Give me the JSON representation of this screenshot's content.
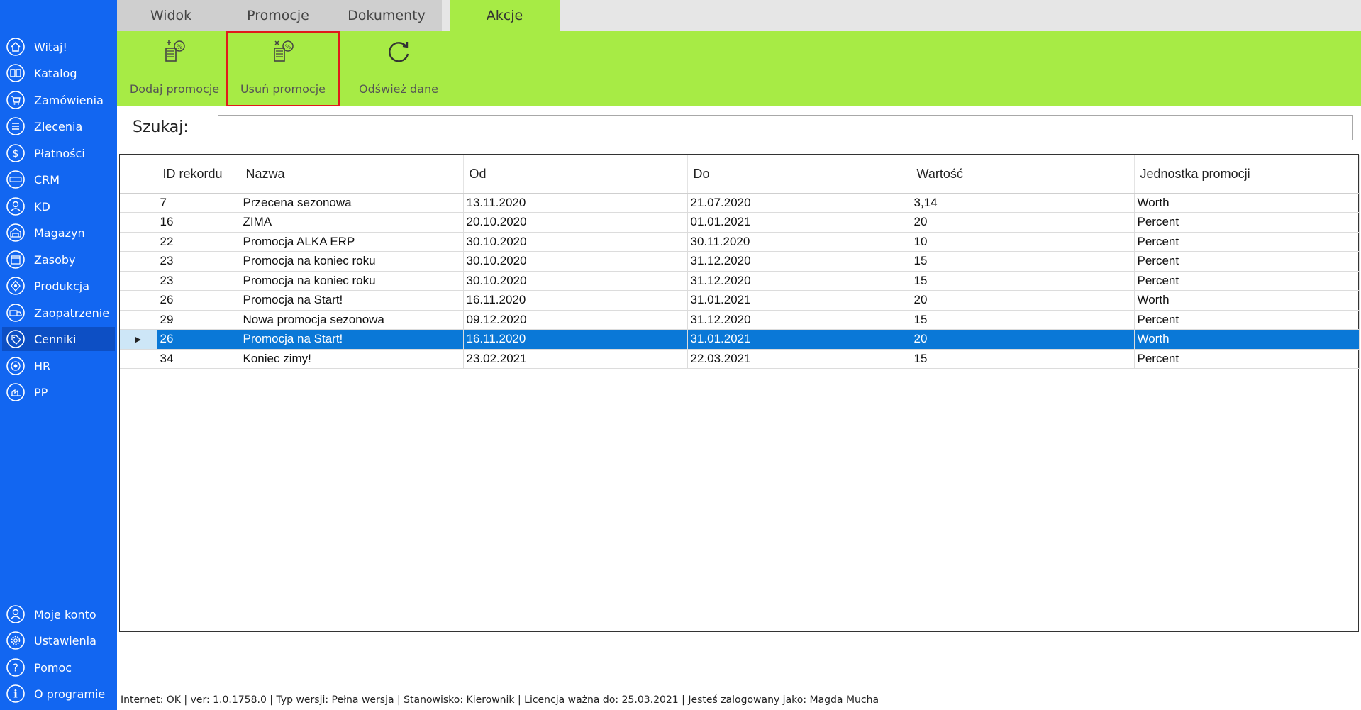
{
  "sidebar": {
    "items": [
      {
        "label": "Witaj!",
        "icon": "home-icon"
      },
      {
        "label": "Katalog",
        "icon": "book-icon"
      },
      {
        "label": "Zamówienia",
        "icon": "cart-icon"
      },
      {
        "label": "Zlecenia",
        "icon": "list-icon"
      },
      {
        "label": "Płatności",
        "icon": "dollar-icon"
      },
      {
        "label": "CRM",
        "icon": "crm-icon"
      },
      {
        "label": "KD",
        "icon": "user-icon"
      },
      {
        "label": "Magazyn",
        "icon": "warehouse-icon"
      },
      {
        "label": "Zasoby",
        "icon": "box-icon"
      },
      {
        "label": "Produkcja",
        "icon": "factory-icon"
      },
      {
        "label": "Zaopatrzenie",
        "icon": "truck-icon"
      },
      {
        "label": "Cenniki",
        "icon": "tag-icon"
      },
      {
        "label": "HR",
        "icon": "target-icon"
      },
      {
        "label": "PP",
        "icon": "pp-icon"
      }
    ],
    "bottom_items": [
      {
        "label": "Moje konto",
        "icon": "account-icon"
      },
      {
        "label": "Ustawienia",
        "icon": "gear-icon"
      },
      {
        "label": "Pomoc",
        "icon": "help-icon"
      },
      {
        "label": "O programie",
        "icon": "info-icon"
      }
    ]
  },
  "tabs": [
    {
      "label": "Widok"
    },
    {
      "label": "Promocje"
    },
    {
      "label": "Dokumenty"
    },
    {
      "label": "Akcje"
    }
  ],
  "ribbon": {
    "add_label": "Dodaj promocje",
    "remove_label": "Usuń promocje",
    "refresh_label": "Odśwież dane"
  },
  "search": {
    "label": "Szukaj:",
    "value": ""
  },
  "table": {
    "columns": [
      "ID rekordu",
      "Nazwa",
      "Od",
      "Do",
      "Wartość",
      "Jednostka promocji"
    ],
    "rows": [
      [
        "7",
        "Przecena sezonowa",
        "13.11.2020",
        "21.07.2020",
        "3,14",
        "Worth"
      ],
      [
        "16",
        "ZIMA",
        "20.10.2020",
        "01.01.2021",
        "20",
        "Percent"
      ],
      [
        "22",
        "Promocja ALKA ERP",
        "30.10.2020",
        "30.11.2020",
        "10",
        "Percent"
      ],
      [
        "23",
        "Promocja na koniec roku",
        "30.10.2020",
        "31.12.2020",
        "15",
        "Percent"
      ],
      [
        "23",
        "Promocja na koniec roku",
        "30.10.2020",
        "31.12.2020",
        "15",
        "Percent"
      ],
      [
        "26",
        "Promocja na Start!",
        "16.11.2020",
        "31.01.2021",
        "20",
        "Worth"
      ],
      [
        "29",
        "Nowa promocja sezonowa",
        "09.12.2020",
        "31.12.2020",
        "15",
        "Percent"
      ],
      [
        "26",
        "Promocja na Start!",
        "16.11.2020",
        "31.01.2021",
        "20",
        "Worth"
      ],
      [
        "34",
        "Koniec zimy!",
        "23.02.2021",
        "22.03.2021",
        "15",
        "Percent"
      ]
    ],
    "selected_row": 7
  },
  "status": "Internet: OK  |   ver: 1.0.1758.0   |   Typ wersji: Pełna wersja   |   Stanowisko: Kierownik   |   Licencja ważna do: 25.03.2021   |   Jesteś zalogowany jako: Magda Mucha",
  "colors": {
    "sidebar": "#1266f1",
    "ribbon": "#a7eb45",
    "selection": "#0a78d7",
    "highlight": "#e01b1b"
  }
}
